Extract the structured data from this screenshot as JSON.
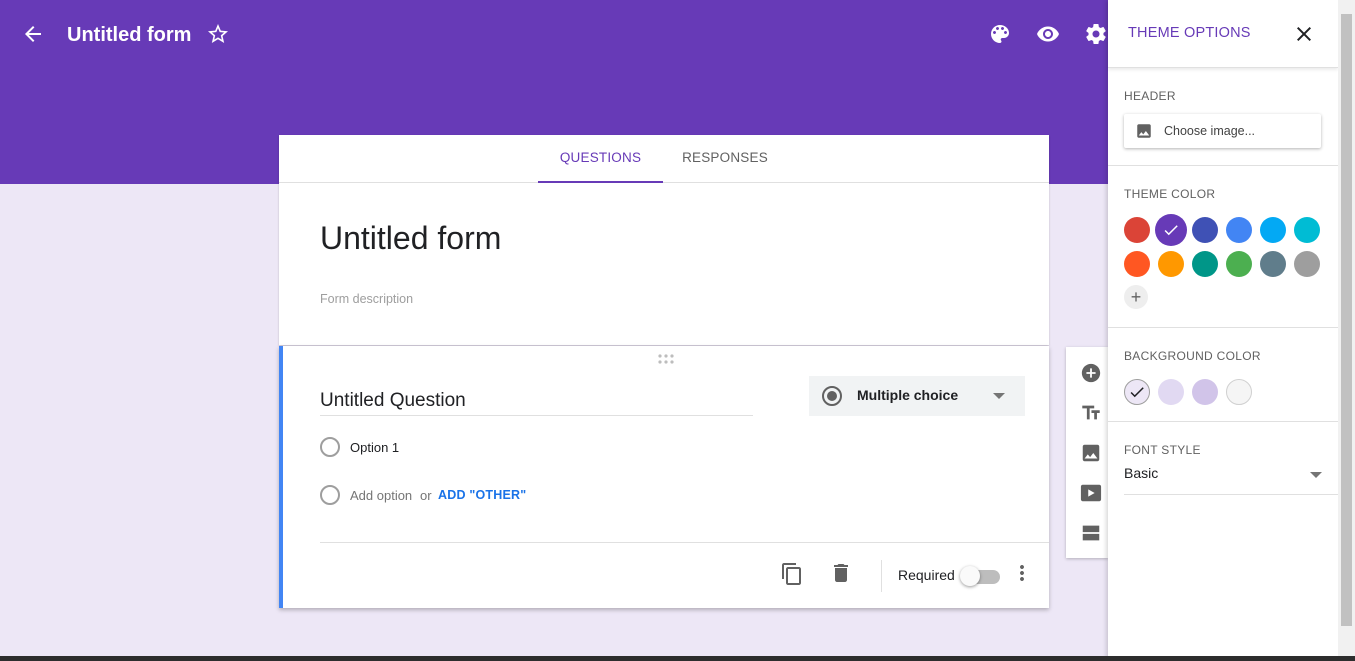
{
  "header": {
    "form_name": "Untitled form",
    "icons": [
      "back-arrow-icon",
      "star-icon",
      "palette-icon",
      "preview-eye-icon",
      "settings-gear-icon"
    ]
  },
  "tabs": [
    {
      "label": "QUESTIONS",
      "active": true
    },
    {
      "label": "RESPONSES",
      "active": false
    }
  ],
  "form": {
    "title": "Untitled form",
    "description_placeholder": "Form description"
  },
  "question": {
    "title": "Untitled Question",
    "type_label": "Multiple choice",
    "options": [
      "Option 1"
    ],
    "add_option_label": "Add option",
    "or_label": "or",
    "add_other_label": "ADD \"OTHER\"",
    "required_label": "Required",
    "required": false
  },
  "side_toolbar": [
    "add-question-icon",
    "add-title-icon",
    "add-image-icon",
    "add-video-icon",
    "add-section-icon"
  ],
  "theme_panel": {
    "title": "THEME OPTIONS",
    "header_label": "HEADER",
    "choose_image_label": "Choose image...",
    "theme_color_label": "THEME COLOR",
    "theme_colors": [
      "#db4437",
      "#673ab7",
      "#3f51b5",
      "#4285f4",
      "#03a9f4",
      "#00bcd4",
      "#ff5722",
      "#ff9800",
      "#009688",
      "#4caf50",
      "#607d8b",
      "#9e9e9e"
    ],
    "selected_theme_color": "#673ab7",
    "add_color_symbol": "+",
    "background_color_label": "BACKGROUND COLOR",
    "background_colors": [
      "#ede7f6",
      "#e1d9f2",
      "#d1c4e9",
      "#f5f5f5"
    ],
    "selected_background_color": "#ede7f6",
    "font_style_label": "FONT STYLE",
    "font_style_value": "Basic"
  }
}
